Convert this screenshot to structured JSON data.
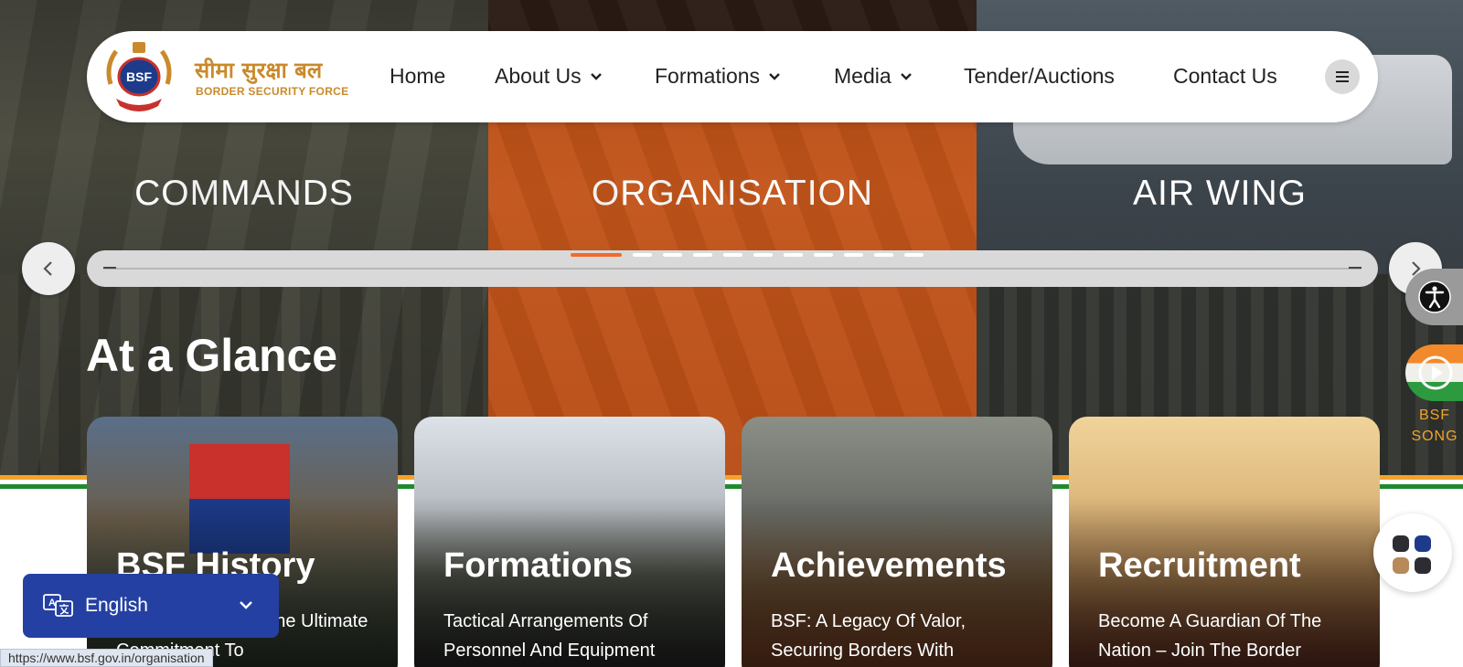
{
  "header": {
    "logo_badge": "BSF",
    "org_name_hindi": "सीमा सुरक्षा बल",
    "org_name_english": "BORDER SECURITY FORCE"
  },
  "nav": {
    "items": [
      {
        "label": "Home",
        "dropdown": false
      },
      {
        "label": "About Us",
        "dropdown": true
      },
      {
        "label": "Formations",
        "dropdown": true
      },
      {
        "label": "Media",
        "dropdown": true
      },
      {
        "label": "Tender/Auctions",
        "dropdown": false
      },
      {
        "label": "Contact Us",
        "dropdown": false
      }
    ],
    "menu_icon": "hamburger-icon"
  },
  "carousel": {
    "panels": [
      "COMMANDS",
      "ORGANISATION",
      "AIR WING"
    ],
    "slide_count": 11,
    "active_slide": 1
  },
  "glance": {
    "title": "At a Glance",
    "cards": [
      {
        "title": "BSF History",
        "desc": "Founded In 1965, The Ultimate Commitment To"
      },
      {
        "title": "Formations",
        "desc": "Tactical Arrangements Of Personnel And Equipment"
      },
      {
        "title": "Achievements",
        "desc": "BSF: A Legacy Of Valor, Securing Borders With"
      },
      {
        "title": "Recruitment",
        "desc": "Become A Guardian Of The Nation – Join The Border"
      }
    ]
  },
  "widgets": {
    "song_label_line1": "BSF",
    "song_label_line2": "SONG"
  },
  "language": {
    "selected": "English"
  },
  "status_bar": {
    "url": "https://www.bsf.gov.in/organisation"
  },
  "colors": {
    "accent_orange": "#f26b2b",
    "brand_gold": "#c98a2b",
    "language_blue": "#2440a3",
    "saffron": "#f2a32b",
    "green": "#1f8a2e"
  }
}
